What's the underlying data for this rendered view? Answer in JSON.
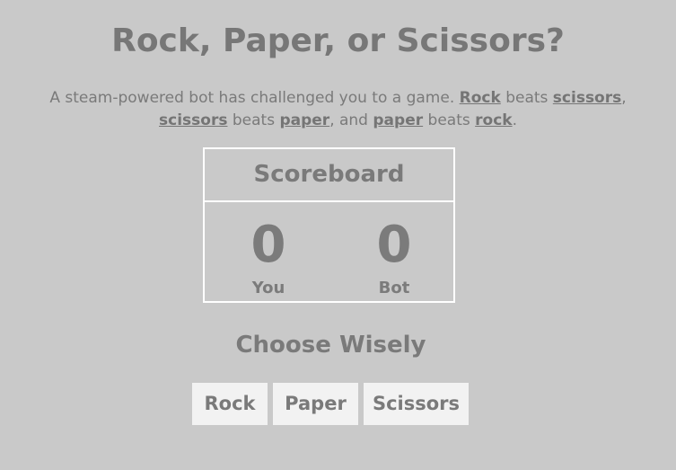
{
  "header": {
    "title": "Rock, Paper, or Scissors?"
  },
  "intro": {
    "t1": "A steam-powered bot has challenged you to a game. ",
    "rock1": "Rock",
    "t2": " beats ",
    "scissors1": "scissors",
    "t3": ",",
    "scissors2": "scissors",
    "t4": " beats ",
    "paper1": "paper",
    "t5": ", and ",
    "paper2": "paper",
    "t6": " beats ",
    "rock2": "rock",
    "t7": "."
  },
  "scoreboard": {
    "title": "Scoreboard",
    "you_score": "0",
    "you_label": "You",
    "bot_score": "0",
    "bot_label": "Bot"
  },
  "choices": {
    "heading": "Choose Wisely",
    "rock": "Rock",
    "paper": "Paper",
    "scissors": "Scissors"
  }
}
